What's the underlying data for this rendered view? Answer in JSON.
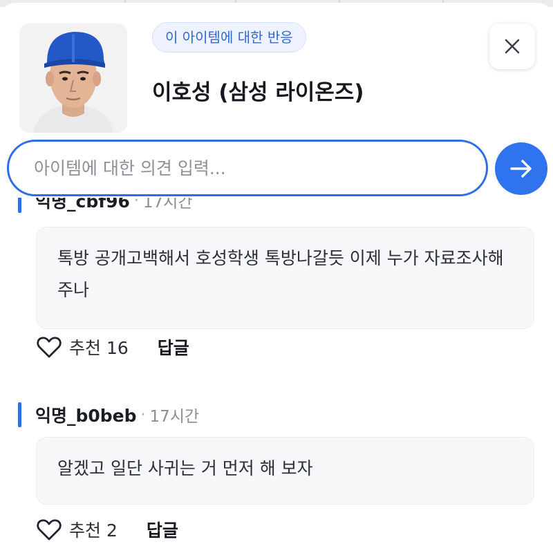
{
  "item": {
    "reaction_badge": "이 아이템에 대한 반응",
    "title": "이호성 (삼성 라이온즈)",
    "thumbnail": "player-portrait"
  },
  "input": {
    "placeholder": "아이템에 대한 의견 입력...",
    "value": ""
  },
  "icons": {
    "close": "close-icon",
    "send": "arrow-right-icon",
    "like": "heart-outline-icon"
  },
  "colors": {
    "accent": "#2f74ee",
    "badge_bg": "#eef3ff",
    "bubble_bg": "#f6f7f9"
  },
  "comments": [
    {
      "author": "익명_cbf96",
      "separator": "·",
      "time": "17시간",
      "text": "톡방 공개고백해서 호성학생 톡방나갈듯 이제 누가 자료조사해주나",
      "like_label": "추천 16",
      "reply_label": "답글"
    },
    {
      "author": "익명_b0beb",
      "separator": "·",
      "time": "17시간",
      "text": "알겠고 일단 사귀는 거 먼저 해 보자",
      "like_label": "추천 2",
      "reply_label": "답글"
    }
  ]
}
